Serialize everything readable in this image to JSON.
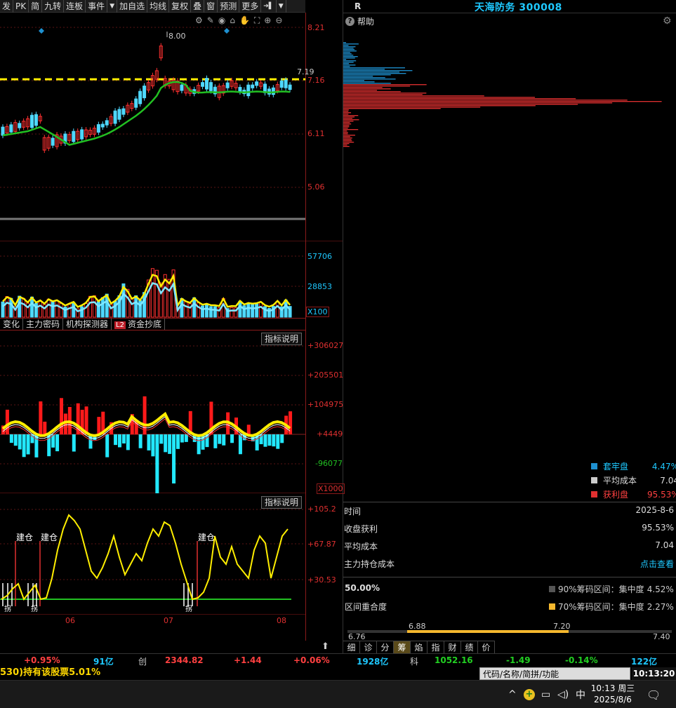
{
  "toolbar": {
    "buttons": [
      "发",
      "PK",
      "简",
      "九转",
      "连板",
      "事件",
      "加自选",
      "均线",
      "复权",
      "叠",
      "窗",
      "预测",
      "更多"
    ]
  },
  "header": {
    "r_label": "R",
    "stock_title": "天海防务 300008",
    "help_label": "帮助"
  },
  "kline": {
    "price_axis": [
      "8.21",
      "7.16",
      "6.11",
      "5.06"
    ],
    "high_marker": "8.00",
    "last_price": "7.19"
  },
  "volume": {
    "axis": [
      "57706",
      "28853"
    ],
    "unit": "X100"
  },
  "indicator_tabs": [
    "变化",
    "主力密码",
    "机构探测器",
    "资金抄底"
  ],
  "l2_badge": "L2",
  "indicator1": {
    "help": "指标说明",
    "axis": [
      "+306027",
      "+205501",
      "+104975",
      "+4449",
      "-96077"
    ],
    "unit": "X1000"
  },
  "indicator2": {
    "help": "指标说明",
    "axis": [
      "+105.2",
      "+67.87",
      "+30.53"
    ],
    "signals": [
      "建仓",
      "建仓",
      "建仓",
      "拐",
      "拐",
      "拐"
    ],
    "months": [
      "06",
      "07",
      "08"
    ]
  },
  "chips": {
    "legend": [
      {
        "label": "套牢盘",
        "value": "4.47%",
        "color": "#1e90d0"
      },
      {
        "label": "平均成本",
        "value": "7.04",
        "color": "#cccccc"
      },
      {
        "label": "获利盘",
        "value": "95.53%",
        "color": "#e03030"
      }
    ],
    "rows": [
      {
        "label": "时间",
        "value": "2025-8-6"
      },
      {
        "label": "收盘获利",
        "value": "95.53%"
      },
      {
        "label": "平均成本",
        "value": "7.04"
      },
      {
        "label": "主力持仓成本",
        "value": "点击查看"
      }
    ],
    "concentration_pct": "50.00%",
    "range90": "90%筹码区间：集中度",
    "range90_val": "4.52%",
    "range70": "70%筹码区间：集中度",
    "range70_val": "2.27%",
    "overlap_label": "区间重合度",
    "scale_labels": [
      "6.88",
      "7.20",
      "6.76",
      "7.40"
    ]
  },
  "bottom_tabs": [
    "细",
    "诊",
    "分",
    "筹",
    "焰",
    "指",
    "财",
    "绩",
    "价"
  ],
  "ticker": {
    "a_pct": "+0.95%",
    "a_amt": "91亿",
    "chuang_label": "创",
    "chuang_val": "2344.82",
    "chuang_chg": "+1.44",
    "chuang_pct": "+0.06%",
    "chuang_amt": "1928亿",
    "ke_label": "科",
    "ke_val": "1052.16",
    "ke_chg": "-1.49",
    "ke_pct": "-0.14%",
    "ke_amt": "122亿"
  },
  "news": "530)持有该股票5.01%",
  "search_placeholder": "代码/名称/简拼/功能",
  "clock_time": "10:13:20",
  "taskbar": {
    "ime": "中",
    "time": "10:13 周三",
    "date": "2025/8/6"
  }
}
